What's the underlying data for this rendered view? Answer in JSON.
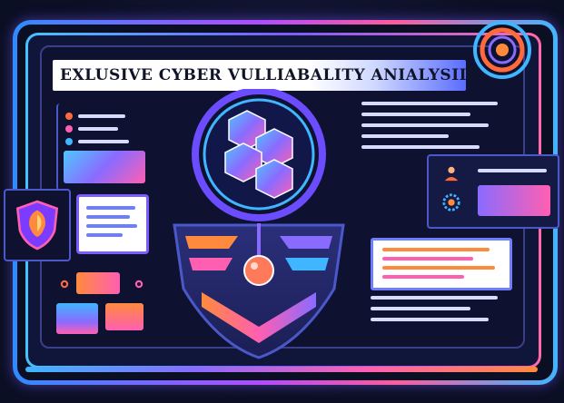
{
  "banner": {
    "title": "EXLUSIVE CYBER VULLIABALITY ANIALYSIIS"
  },
  "icons": {
    "shield": "shield-icon",
    "emblem": "hex-emblem-icon",
    "target": "target-icon",
    "user": "user-icon",
    "gear": "gear-icon",
    "lock": "lock-icon"
  },
  "colors": {
    "accent_blue": "#3fb6ff",
    "accent_purple": "#8a6bff",
    "accent_pink": "#ff5fb1",
    "accent_orange": "#ff8a3d",
    "background": "#0b0f24"
  }
}
